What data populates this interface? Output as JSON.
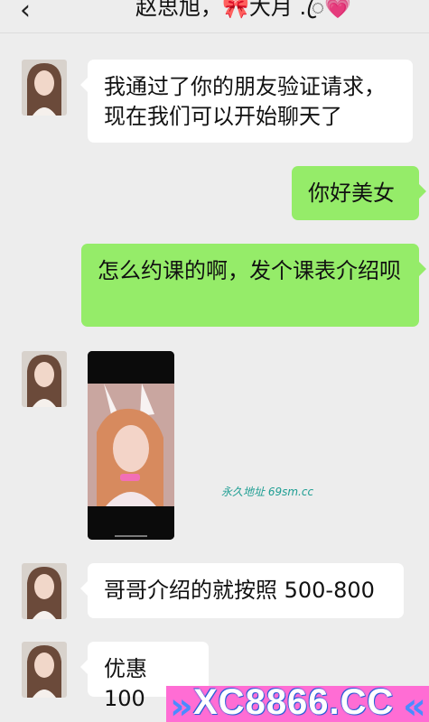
{
  "header": {
    "back_icon": "chevron-left-icon",
    "title": "赵思旭，🎀大月 .ꦿ💗"
  },
  "messages": [
    {
      "sender": "contact",
      "type": "text",
      "text": "我通过了你的朋友验证请求，现在我们可以开始聊天了"
    },
    {
      "sender": "me",
      "type": "text",
      "text": "你好美女"
    },
    {
      "sender": "me",
      "type": "text",
      "text": "怎么约课的啊，发个课表介绍呗"
    },
    {
      "sender": "contact",
      "type": "video"
    },
    {
      "sender": "contact",
      "type": "text",
      "text": "哥哥介绍的就按照 500-800"
    },
    {
      "sender": "contact",
      "type": "text",
      "text": "优惠 100"
    }
  ],
  "overlays": {
    "watermark": "永久地址 69sm.cc",
    "banner": "XC8866.CC"
  },
  "colors": {
    "background": "#ededed",
    "incoming_bubble": "#ffffff",
    "outgoing_bubble": "#95ec69",
    "banner": "#ff6dd4"
  }
}
